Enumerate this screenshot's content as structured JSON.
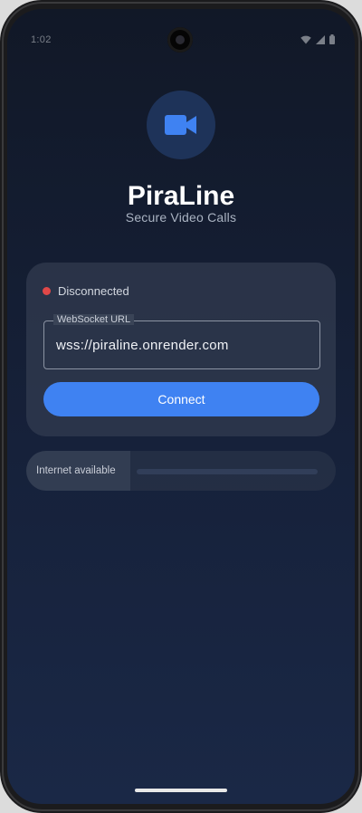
{
  "status_bar": {
    "time": "1:02",
    "icons": [
      "wifi-icon",
      "signal-icon",
      "battery-icon"
    ]
  },
  "app": {
    "logo_icon": "video-camera-icon",
    "title": "PiraLine",
    "subtitle": "Secure Video Calls"
  },
  "connection": {
    "status": "Disconnected",
    "status_color": "#e04848",
    "url_label": "WebSocket URL",
    "url_value": "wss://piraline.onrender.com",
    "connect_label": "Connect",
    "accent_color": "#3f82f2"
  },
  "network": {
    "label": "Internet available"
  }
}
